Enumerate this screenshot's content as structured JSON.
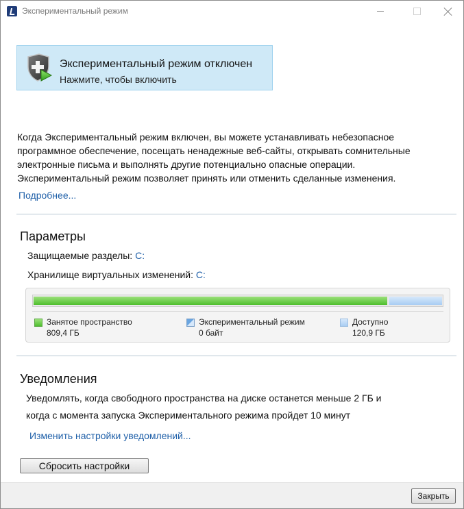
{
  "window": {
    "title": "Экспериментальный режим",
    "icon": "app-icon",
    "controls": [
      "minimize-icon",
      "maximize-icon",
      "close-icon"
    ]
  },
  "banner": {
    "icon": "shield-play-icon",
    "title": "Экспериментальный режим отключен",
    "subtitle": "Нажмите, чтобы включить"
  },
  "description": {
    "lines": [
      "Когда Экспериментальный режим включен, вы можете устанавливать небезопасное",
      "программное обеспечение, посещать ненадежные веб-сайты, открывать сомнительные",
      "электронные письма и выполнять другие потенциально опасные операции.",
      "Экспериментальный режим позволяет принять или отменить сделанные изменения."
    ],
    "more_link": "Подробнее..."
  },
  "parameters": {
    "heading": "Параметры",
    "protected_label": "Защищаемые разделы:",
    "protected_value": "C:",
    "storage_label": "Хранилище виртуальных изменений:",
    "storage_value": "C:"
  },
  "usage": {
    "used_fraction": 0.87,
    "experimental_fraction": 0.0,
    "free_fraction": 0.13,
    "colors": {
      "used": "#4fbf2e",
      "experimental": "#6aa5e0",
      "free": "#a9cdf3"
    },
    "legend": [
      {
        "label": "Занятое пространство",
        "value": "809,4 ГБ"
      },
      {
        "label": "Экспериментальный режим",
        "value": "0 байт"
      },
      {
        "label": "Доступно",
        "value": "120,9 ГБ"
      }
    ]
  },
  "notifications": {
    "heading": "Уведомления",
    "line1": "Уведомлять, когда свободного пространства на диске останется меньше 2 ГБ и",
    "line2": "когда с момента запуска Экспериментального режима пройдет 10 минут",
    "link": "Изменить настройки уведомлений..."
  },
  "buttons": {
    "reset": "Сбросить настройки",
    "close": "Закрыть"
  },
  "colors": {
    "link": "#1e5fa8",
    "banner_bg": "#cfe9f7"
  }
}
